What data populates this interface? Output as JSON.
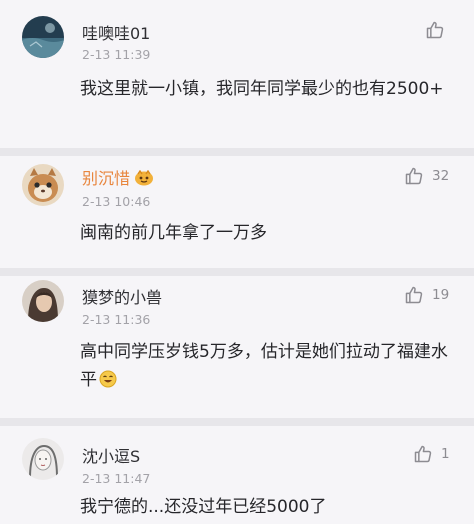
{
  "comments": [
    {
      "username": "哇噢哇01",
      "timestamp": "2-13 11:39",
      "content": "我这里就一小镇，我同年同学最少的也有2500+",
      "likes": "",
      "avatar": "ocean-scene-avatar"
    },
    {
      "username": "别沉惜",
      "timestamp": "2-13 10:46",
      "content": "闽南的前几年拿了一万多",
      "likes": "32",
      "avatar": "cat-avatar",
      "badge": "vip-badge"
    },
    {
      "username": "獏梦的小兽",
      "timestamp": "2-13 11:36",
      "content": "高中同学压岁钱5万多，估计是她们拉动了福建水平",
      "likes": "19",
      "avatar": "portrait-avatar",
      "emoji": "laughing-emoji"
    },
    {
      "username": "沈小逗S",
      "timestamp": "2-13 11:47",
      "content": "我宁德的...还没过年已经5000了",
      "likes": "1",
      "avatar": "girl-sketch-avatar"
    }
  ],
  "colors": {
    "background": "#e7e6ea",
    "card": "#f6f5f8",
    "vip_username": "#e8853d",
    "timestamp": "#a3a2a8",
    "like_icon": "#8d8c92"
  }
}
